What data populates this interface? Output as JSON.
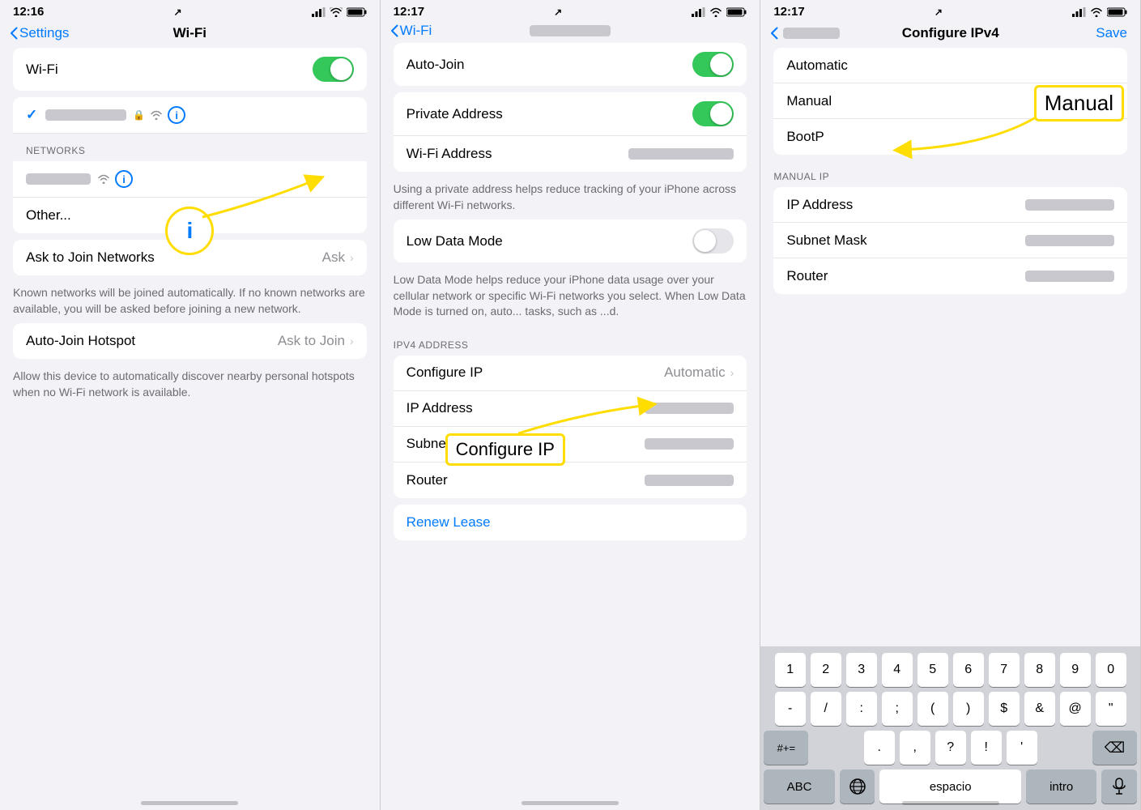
{
  "panel1": {
    "status": {
      "time": "12:16",
      "arrow": "↗",
      "signal": "...",
      "wifi": "wifi",
      "battery": "battery"
    },
    "nav": {
      "back_label": "Settings",
      "title": "Wi-Fi"
    },
    "wifi_row": {
      "label": "Wi-Fi",
      "toggle_state": "on"
    },
    "networks_header": "NETWORKS",
    "other_label": "Other...",
    "ask_networks": {
      "label": "Ask to Join Networks",
      "value": "Ask"
    },
    "ask_networks_desc": "Known networks will be joined automatically. If no known networks are available, you will be asked before joining a new network.",
    "auto_join": {
      "label": "Auto-Join Hotspot",
      "value": "Ask to Join"
    },
    "auto_join_desc": "Allow this device to automatically discover nearby personal hotspots when no Wi-Fi network is available."
  },
  "panel2": {
    "status": {
      "time": "12:17",
      "arrow": "↗"
    },
    "nav": {
      "back_label": "Wi-Fi",
      "title": ""
    },
    "auto_join": {
      "label": "Auto-Join",
      "toggle": "on"
    },
    "private_address": {
      "label": "Private Address",
      "toggle": "on"
    },
    "wifi_address": {
      "label": "Wi-Fi Address"
    },
    "wifi_address_desc": "Using a private address helps reduce tracking of your iPhone across different Wi-Fi networks.",
    "low_data": {
      "label": "Low Data Mode",
      "toggle": "off"
    },
    "low_data_desc": "Low Data Mode helps reduce your iPhone data usage over your cellular network or specific Wi-Fi networks you select. When Low Data Mode is turned on, auto... tasks, such as ...d.",
    "ipv4_header": "IPV4 ADDRESS",
    "configure_ip": {
      "label": "Configure IP",
      "value": "Automatic"
    },
    "ip_address": {
      "label": "IP Address"
    },
    "subnet_mask": {
      "label": "Subnet Mask"
    },
    "router": {
      "label": "Router"
    },
    "renew_lease": "Renew Lease",
    "annotation_label": "Configure IP"
  },
  "panel3": {
    "status": {
      "time": "12:17",
      "arrow": "↗"
    },
    "nav": {
      "back_label": "",
      "title": "Configure IPv4",
      "save_label": "Save"
    },
    "options": [
      {
        "label": "Automatic",
        "selected": false
      },
      {
        "label": "Manual",
        "selected": true
      },
      {
        "label": "BootP",
        "selected": false
      }
    ],
    "manual_ip_header": "MANUAL IP",
    "ip_address": {
      "label": "IP Address"
    },
    "subnet_mask": {
      "label": "Subnet Mask"
    },
    "router": {
      "label": "Router"
    },
    "annotation_label": "Manual",
    "keyboard": {
      "row1": [
        "1",
        "2",
        "3",
        "4",
        "5",
        "6",
        "7",
        "8",
        "9",
        "0"
      ],
      "row2": [
        "-",
        "/",
        ":",
        ";",
        "(",
        ")",
        "$",
        "&",
        "@",
        "\""
      ],
      "row3_left": "#+=",
      "row3_mid": [
        ".",
        ",",
        "?",
        "!",
        "'"
      ],
      "row3_right": "⌫",
      "bottom": [
        "ABC",
        "espacio",
        "intro"
      ]
    }
  }
}
